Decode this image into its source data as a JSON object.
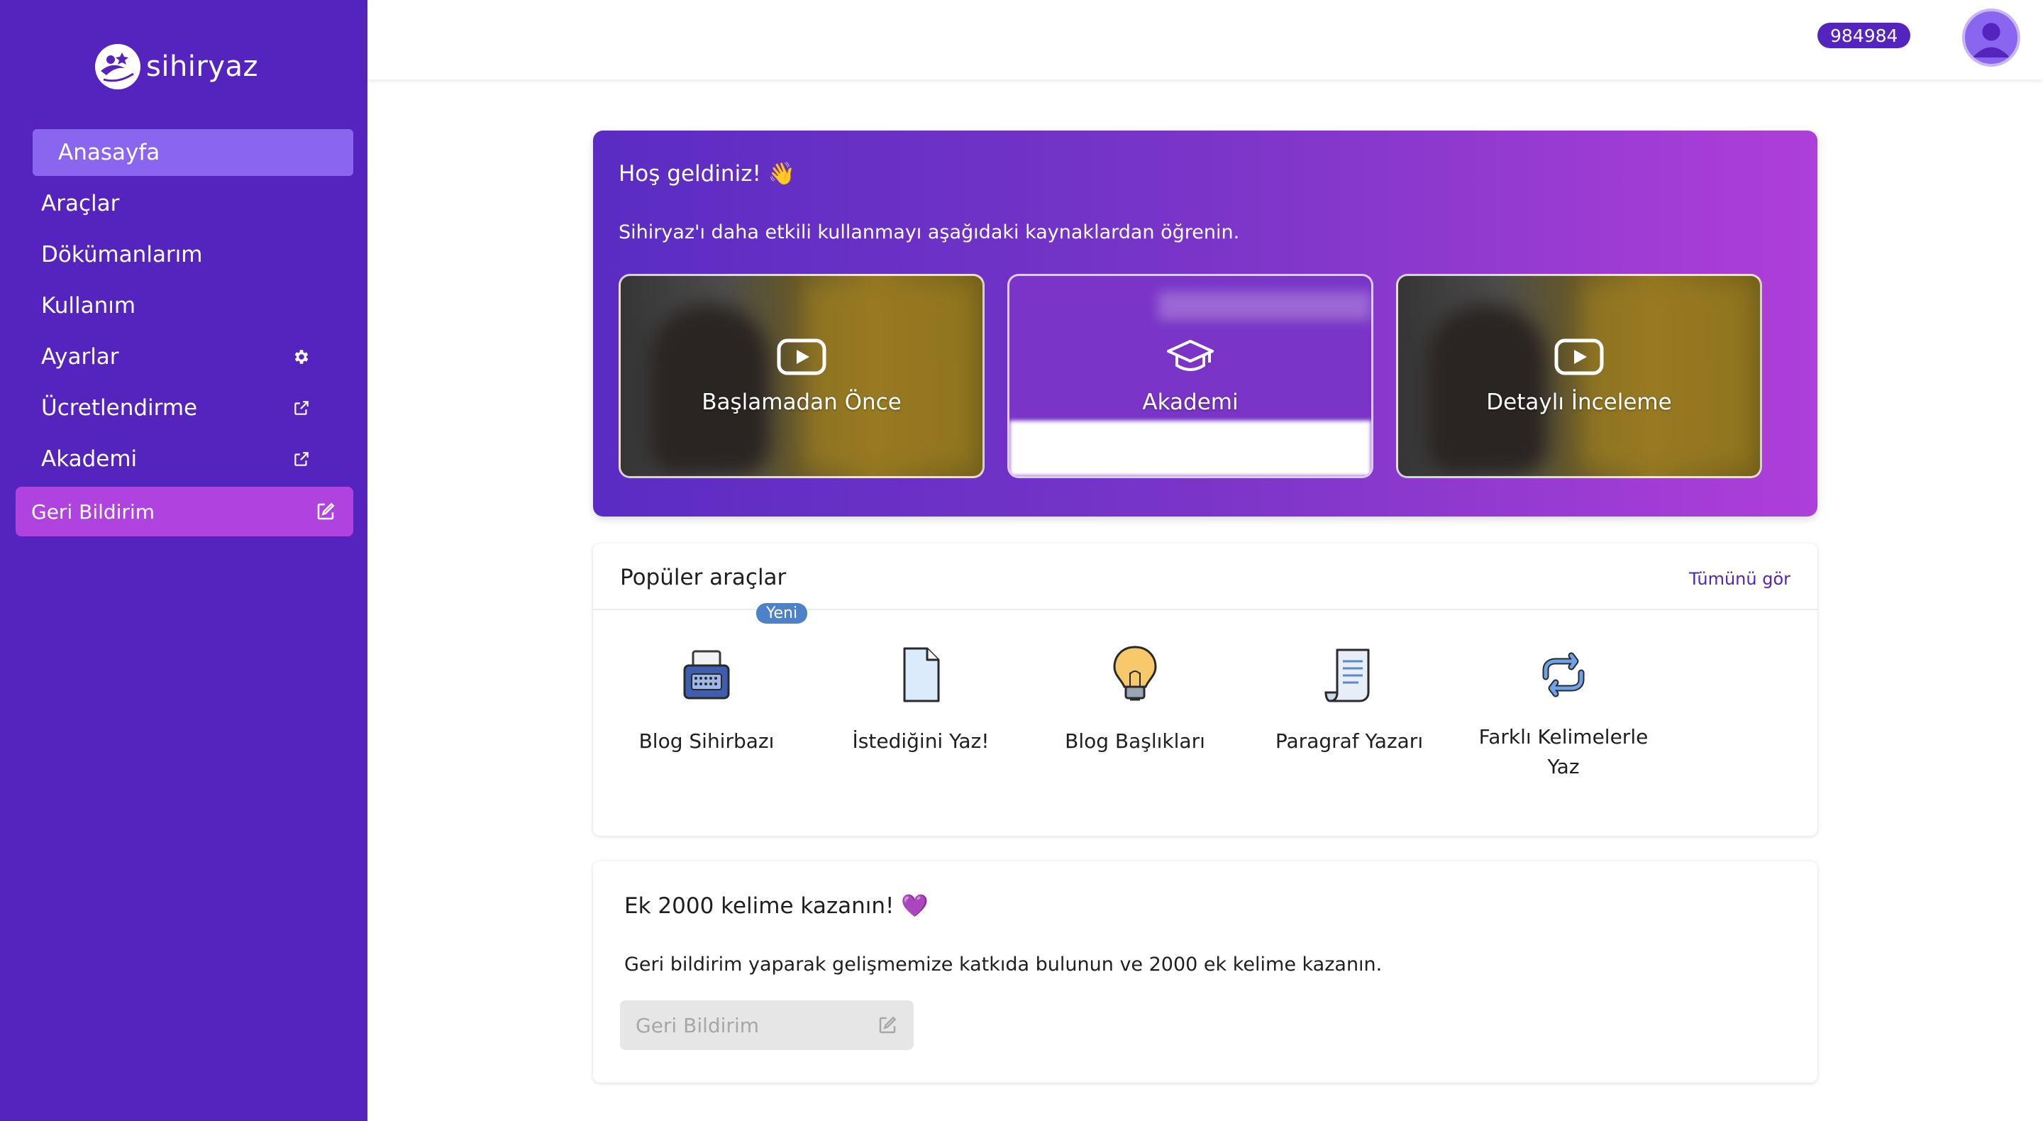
{
  "app": {
    "logo_text": "sihiryaz"
  },
  "sidebar": {
    "items": [
      {
        "label": "Anasayfa"
      },
      {
        "label": "Araçlar"
      },
      {
        "label": "Dökümanlarım"
      },
      {
        "label": "Kullanım"
      },
      {
        "label": "Ayarlar",
        "icon": "gear-icon"
      },
      {
        "label": "Ücretlendirme",
        "icon": "external-link-icon"
      },
      {
        "label": "Akademi",
        "icon": "external-link-icon"
      }
    ],
    "feedback": {
      "label": "Geri Bildirim",
      "icon": "edit-icon"
    }
  },
  "header": {
    "credits": "984984"
  },
  "welcome": {
    "title": "Hoş geldiniz! 👋",
    "subtitle": "Sihiryaz'ı daha etkili kullanmayı aşağıdaki kaynaklardan öğrenin.",
    "cards": [
      {
        "label": "Başlamadan Önce",
        "icon": "play-icon"
      },
      {
        "label": "Akademi",
        "icon": "graduation-cap-icon"
      },
      {
        "label": "Detaylı İnceleme",
        "icon": "play-icon"
      }
    ]
  },
  "tools": {
    "title": "Popüler araçlar",
    "see_all": "Tümünü gör",
    "items": [
      {
        "label": "Blog Sihirbazı",
        "badge": "Yeni",
        "icon": "typewriter-icon"
      },
      {
        "label": "İstediğini Yaz!",
        "icon": "document-icon"
      },
      {
        "label": "Blog Başlıkları",
        "icon": "lightbulb-icon"
      },
      {
        "label": "Paragraf Yazarı",
        "icon": "scroll-icon"
      },
      {
        "label": "Farklı Kelimelerle Yaz",
        "icon": "repeat-icon"
      }
    ]
  },
  "bonus": {
    "title": "Ek 2000 kelime kazanın! 💜",
    "description": "Geri bildirim yaparak gelişmemize katkıda bulunun ve 2000 ek kelime kazanın.",
    "button_label": "Geri Bildirim"
  },
  "colors": {
    "sidebar": "#5524bf",
    "accent": "#8a66f0",
    "feedback": "#b043e0",
    "badge": "#4d82c8"
  }
}
